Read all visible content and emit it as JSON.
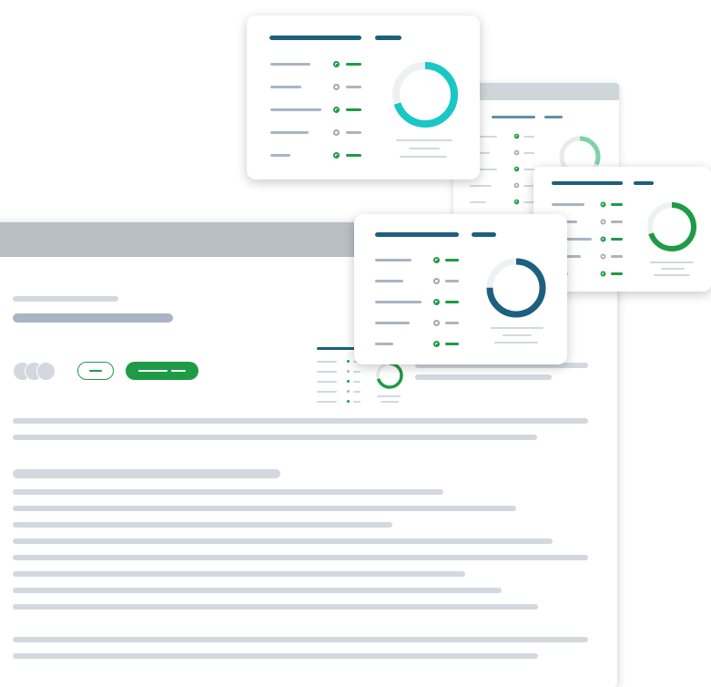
{
  "scene": {
    "description_visible_text": "",
    "colors": {
      "navy": "#1d5f7e",
      "green": "#1e9b46",
      "teal": "#19c7c7",
      "placeholder": "#d3d8df",
      "titlebar": "#b7bfc4"
    }
  },
  "cards": [
    {
      "name": "dashboard-card-top",
      "rows": [
        true,
        false,
        true,
        false,
        true
      ],
      "ring_color": "#19c7c7",
      "ring_fraction": 0.7
    },
    {
      "name": "dashboard-card-middle",
      "rows": [
        true,
        false,
        true,
        false,
        true
      ],
      "ring_color": "#1d5f7e",
      "ring_fraction": 0.75
    },
    {
      "name": "dashboard-card-right",
      "rows": [
        true,
        false,
        true,
        false,
        true
      ],
      "ring_color": "#1e9b46",
      "ring_fraction": 0.7
    }
  ],
  "icons": [
    "status-on-icon",
    "status-off-icon",
    "avatar-icon"
  ]
}
